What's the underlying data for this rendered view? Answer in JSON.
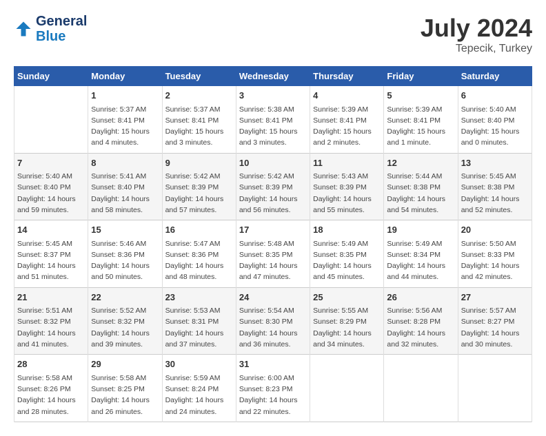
{
  "logo": {
    "line1": "General",
    "line2": "Blue"
  },
  "title": "July 2024",
  "subtitle": "Tepecik, Turkey",
  "columns": [
    "Sunday",
    "Monday",
    "Tuesday",
    "Wednesday",
    "Thursday",
    "Friday",
    "Saturday"
  ],
  "weeks": [
    [
      {
        "day": "",
        "info": ""
      },
      {
        "day": "1",
        "info": "Sunrise: 5:37 AM\nSunset: 8:41 PM\nDaylight: 15 hours\nand 4 minutes."
      },
      {
        "day": "2",
        "info": "Sunrise: 5:37 AM\nSunset: 8:41 PM\nDaylight: 15 hours\nand 3 minutes."
      },
      {
        "day": "3",
        "info": "Sunrise: 5:38 AM\nSunset: 8:41 PM\nDaylight: 15 hours\nand 3 minutes."
      },
      {
        "day": "4",
        "info": "Sunrise: 5:39 AM\nSunset: 8:41 PM\nDaylight: 15 hours\nand 2 minutes."
      },
      {
        "day": "5",
        "info": "Sunrise: 5:39 AM\nSunset: 8:41 PM\nDaylight: 15 hours\nand 1 minute."
      },
      {
        "day": "6",
        "info": "Sunrise: 5:40 AM\nSunset: 8:40 PM\nDaylight: 15 hours\nand 0 minutes."
      }
    ],
    [
      {
        "day": "7",
        "info": "Sunrise: 5:40 AM\nSunset: 8:40 PM\nDaylight: 14 hours\nand 59 minutes."
      },
      {
        "day": "8",
        "info": "Sunrise: 5:41 AM\nSunset: 8:40 PM\nDaylight: 14 hours\nand 58 minutes."
      },
      {
        "day": "9",
        "info": "Sunrise: 5:42 AM\nSunset: 8:39 PM\nDaylight: 14 hours\nand 57 minutes."
      },
      {
        "day": "10",
        "info": "Sunrise: 5:42 AM\nSunset: 8:39 PM\nDaylight: 14 hours\nand 56 minutes."
      },
      {
        "day": "11",
        "info": "Sunrise: 5:43 AM\nSunset: 8:39 PM\nDaylight: 14 hours\nand 55 minutes."
      },
      {
        "day": "12",
        "info": "Sunrise: 5:44 AM\nSunset: 8:38 PM\nDaylight: 14 hours\nand 54 minutes."
      },
      {
        "day": "13",
        "info": "Sunrise: 5:45 AM\nSunset: 8:38 PM\nDaylight: 14 hours\nand 52 minutes."
      }
    ],
    [
      {
        "day": "14",
        "info": "Sunrise: 5:45 AM\nSunset: 8:37 PM\nDaylight: 14 hours\nand 51 minutes."
      },
      {
        "day": "15",
        "info": "Sunrise: 5:46 AM\nSunset: 8:36 PM\nDaylight: 14 hours\nand 50 minutes."
      },
      {
        "day": "16",
        "info": "Sunrise: 5:47 AM\nSunset: 8:36 PM\nDaylight: 14 hours\nand 48 minutes."
      },
      {
        "day": "17",
        "info": "Sunrise: 5:48 AM\nSunset: 8:35 PM\nDaylight: 14 hours\nand 47 minutes."
      },
      {
        "day": "18",
        "info": "Sunrise: 5:49 AM\nSunset: 8:35 PM\nDaylight: 14 hours\nand 45 minutes."
      },
      {
        "day": "19",
        "info": "Sunrise: 5:49 AM\nSunset: 8:34 PM\nDaylight: 14 hours\nand 44 minutes."
      },
      {
        "day": "20",
        "info": "Sunrise: 5:50 AM\nSunset: 8:33 PM\nDaylight: 14 hours\nand 42 minutes."
      }
    ],
    [
      {
        "day": "21",
        "info": "Sunrise: 5:51 AM\nSunset: 8:32 PM\nDaylight: 14 hours\nand 41 minutes."
      },
      {
        "day": "22",
        "info": "Sunrise: 5:52 AM\nSunset: 8:32 PM\nDaylight: 14 hours\nand 39 minutes."
      },
      {
        "day": "23",
        "info": "Sunrise: 5:53 AM\nSunset: 8:31 PM\nDaylight: 14 hours\nand 37 minutes."
      },
      {
        "day": "24",
        "info": "Sunrise: 5:54 AM\nSunset: 8:30 PM\nDaylight: 14 hours\nand 36 minutes."
      },
      {
        "day": "25",
        "info": "Sunrise: 5:55 AM\nSunset: 8:29 PM\nDaylight: 14 hours\nand 34 minutes."
      },
      {
        "day": "26",
        "info": "Sunrise: 5:56 AM\nSunset: 8:28 PM\nDaylight: 14 hours\nand 32 minutes."
      },
      {
        "day": "27",
        "info": "Sunrise: 5:57 AM\nSunset: 8:27 PM\nDaylight: 14 hours\nand 30 minutes."
      }
    ],
    [
      {
        "day": "28",
        "info": "Sunrise: 5:58 AM\nSunset: 8:26 PM\nDaylight: 14 hours\nand 28 minutes."
      },
      {
        "day": "29",
        "info": "Sunrise: 5:58 AM\nSunset: 8:25 PM\nDaylight: 14 hours\nand 26 minutes."
      },
      {
        "day": "30",
        "info": "Sunrise: 5:59 AM\nSunset: 8:24 PM\nDaylight: 14 hours\nand 24 minutes."
      },
      {
        "day": "31",
        "info": "Sunrise: 6:00 AM\nSunset: 8:23 PM\nDaylight: 14 hours\nand 22 minutes."
      },
      {
        "day": "",
        "info": ""
      },
      {
        "day": "",
        "info": ""
      },
      {
        "day": "",
        "info": ""
      }
    ]
  ]
}
